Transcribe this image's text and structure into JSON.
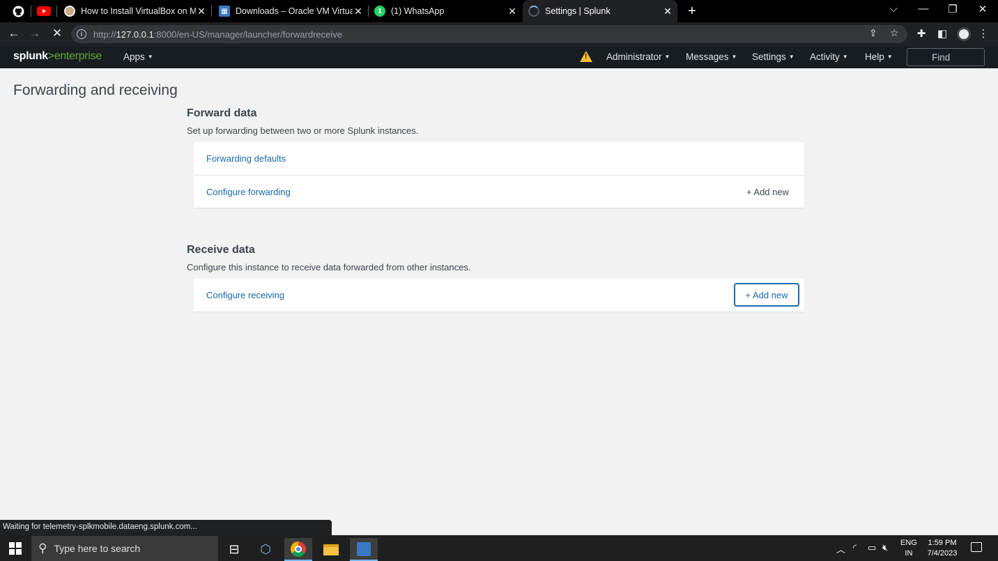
{
  "browser": {
    "tabs": [
      {
        "title": "How to Install VirtualBox on Mac",
        "favicon": "virtualbox-site-icon"
      },
      {
        "title": "Downloads – Oracle VM VirtualBox",
        "favicon": "virtualbox-icon"
      },
      {
        "title": "(1) WhatsApp",
        "favicon": "whatsapp-icon"
      },
      {
        "title": "Settings | Splunk",
        "favicon": "loading-spinner-icon",
        "active": true
      }
    ],
    "url_prefix": "http://",
    "url_host": "127.0.0.1",
    "url_path": ":8000/en-US/manager/launcher/forwardreceive",
    "status_text": "Waiting for telemetry-splkmobile.dataeng.splunk.com..."
  },
  "splunk_nav": {
    "logo_main": "splunk",
    "logo_suffix": ">enterprise",
    "apps": "Apps",
    "administrator": "Administrator",
    "messages": "Messages",
    "settings": "Settings",
    "activity": "Activity",
    "help": "Help",
    "find": "Find"
  },
  "page": {
    "title": "Forwarding and receiving",
    "forward": {
      "title": "Forward data",
      "description": "Set up forwarding between two or more Splunk instances.",
      "rows": [
        {
          "label": "Forwarding defaults"
        },
        {
          "label": "Configure forwarding",
          "action": "+ Add new"
        }
      ]
    },
    "receive": {
      "title": "Receive data",
      "description": "Configure this instance to receive data forwarded from other instances.",
      "rows": [
        {
          "label": "Configure receiving",
          "action": "+ Add new"
        }
      ]
    }
  },
  "taskbar": {
    "search_placeholder": "Type here to search",
    "lang_line1": "ENG",
    "lang_line2": "IN",
    "time": "1:59 PM",
    "date": "7/4/2023"
  },
  "colors": {
    "splunk_nav_bg": "#171d21",
    "splunk_green": "#65a637",
    "link_blue": "#1a6aa8",
    "warning_yellow": "#f8be34"
  }
}
